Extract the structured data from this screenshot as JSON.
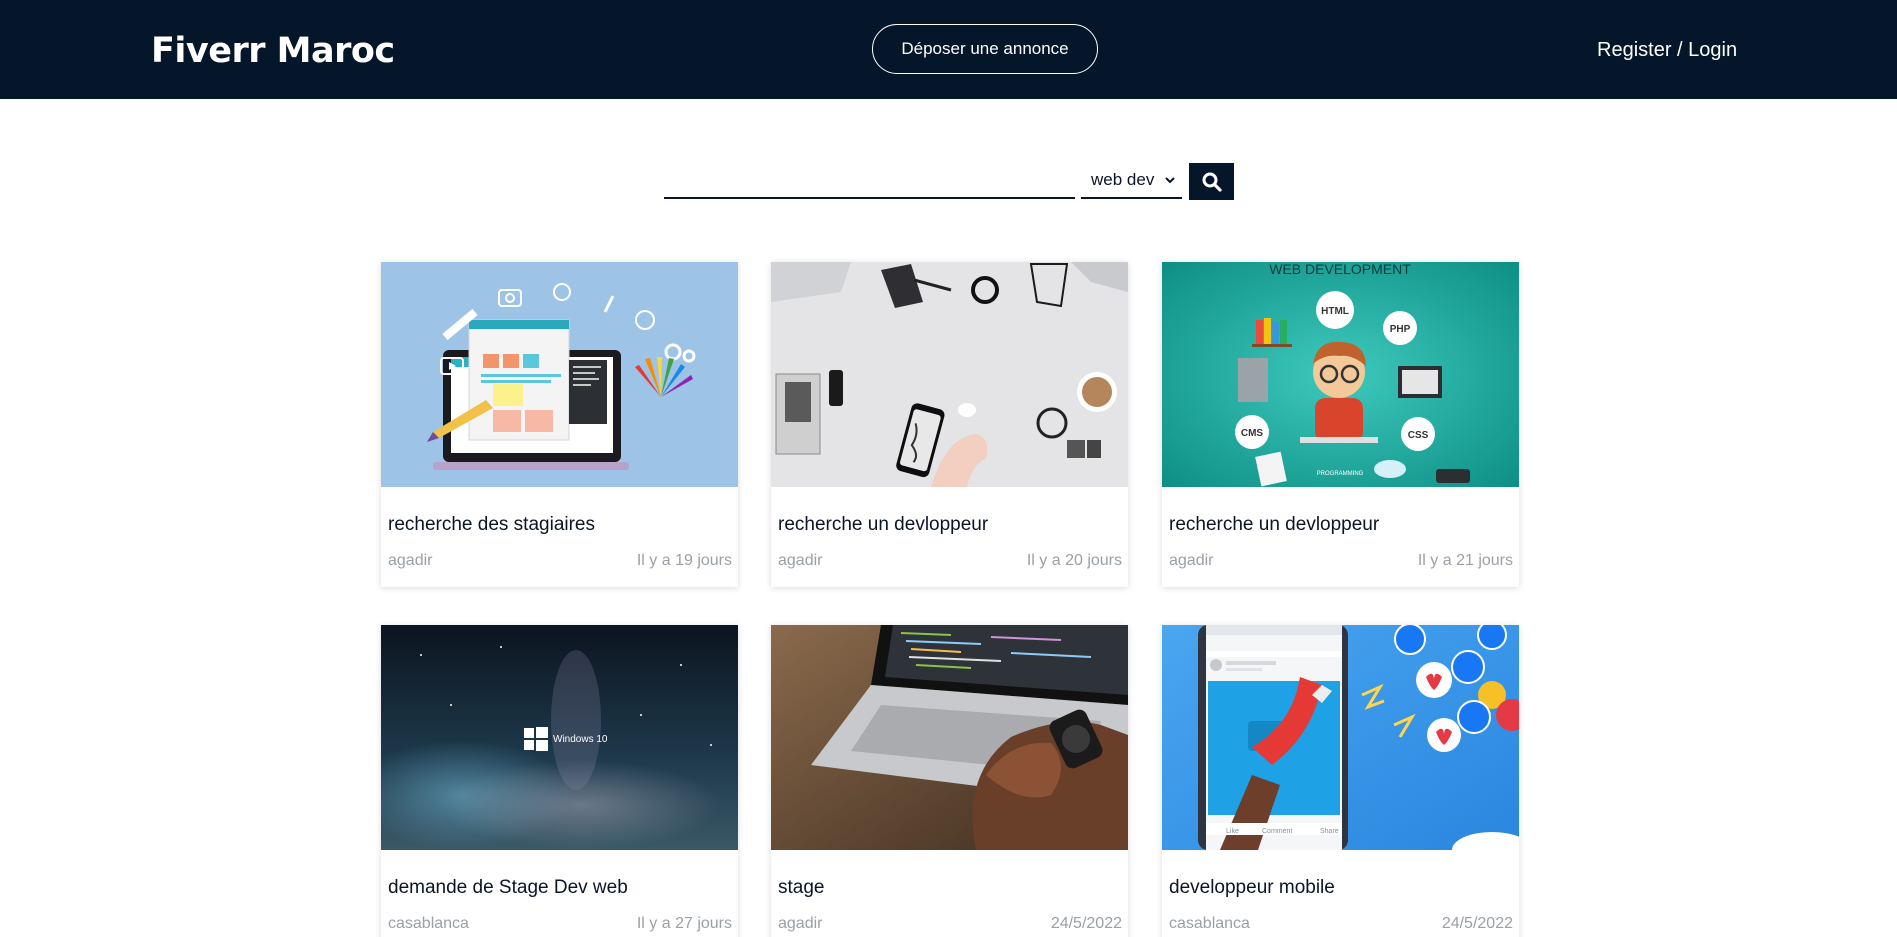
{
  "header": {
    "brand": "Fiverr Maroc",
    "post_button": "Déposer une annonce",
    "auth_link": "Register / Login",
    "background": "#06162a"
  },
  "search": {
    "query": "",
    "category": "web dev",
    "button_icon": "search-icon"
  },
  "listings": [
    {
      "title": "recherche des stagiaires",
      "city": "agadir",
      "age": "Il y a 19 jours",
      "image": "web-design-laptop-illustration"
    },
    {
      "title": "recherche un devloppeur",
      "city": "agadir",
      "age": "Il y a 20 jours",
      "image": "desk-flatlay-phone"
    },
    {
      "title": "recherche un devloppeur",
      "city": "agadir",
      "age": "Il y a 21 jours",
      "image": "web-development-developer-illustration",
      "image_text": {
        "heading": "WEB DEVELOPMENT",
        "badges": [
          "HTML",
          "PHP",
          "CMS",
          "CSS"
        ],
        "caption": "PROGRAMMING"
      }
    },
    {
      "title": "demande de Stage Dev web",
      "city": "casablanca",
      "age": "Il y a 27 jours",
      "image": "windows-10-wallpaper",
      "image_text": {
        "logo": "Windows 10"
      }
    },
    {
      "title": "stage",
      "city": "agadir",
      "age": "24/5/2022",
      "image": "laptop-coding-hands"
    },
    {
      "title": "developpeur mobile",
      "city": "casablanca",
      "age": "24/5/2022",
      "image": "social-media-phone-magnet",
      "image_text": {
        "actions": [
          "Like",
          "Comment",
          "Share"
        ]
      }
    }
  ]
}
